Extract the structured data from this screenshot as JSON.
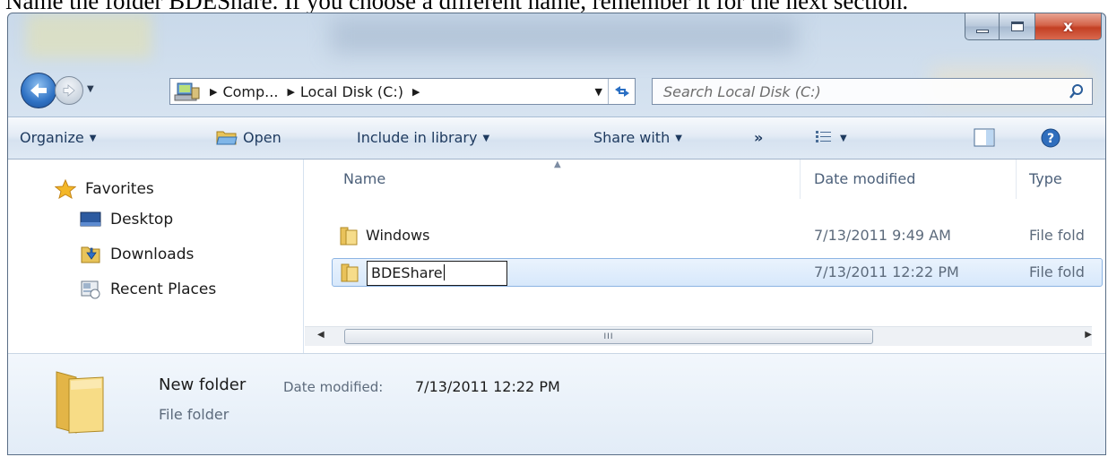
{
  "document": {
    "caption": "Name the folder BDEShare.  If you choose a different name, remember it for the next section."
  },
  "window": {
    "close_glyph": "x"
  },
  "address": {
    "crumbs": [
      "Comp...",
      "Local Disk (C:)"
    ]
  },
  "search": {
    "placeholder": "Search Local Disk (C:)"
  },
  "toolbar": {
    "organize": "Organize",
    "open": "Open",
    "include_in_library": "Include in library",
    "share_with": "Share with",
    "more": "»"
  },
  "nav_pane": {
    "favorites": "Favorites",
    "items": [
      {
        "label": "Desktop",
        "icon": "desktop-icon"
      },
      {
        "label": "Downloads",
        "icon": "downloads-icon"
      },
      {
        "label": "Recent Places",
        "icon": "recent-places-icon"
      }
    ]
  },
  "file_list": {
    "columns": [
      "Name",
      "Date modified",
      "Type"
    ],
    "rows": [
      {
        "name": "Windows",
        "date": "7/13/2011 9:49 AM",
        "type": "File fold"
      },
      {
        "name": "BDEShare",
        "date": "7/13/2011 12:22 PM",
        "type": "File fold",
        "selected": true,
        "editing": true
      }
    ],
    "scroll_grip": "III"
  },
  "details_pane": {
    "name": "New folder",
    "date_label": "Date modified:",
    "date": "7/13/2011 12:22 PM",
    "type": "File folder"
  },
  "colors": {
    "selection": "#d7e8fb",
    "selection_border": "#8cb4e3",
    "close_red": "#c33f23"
  }
}
